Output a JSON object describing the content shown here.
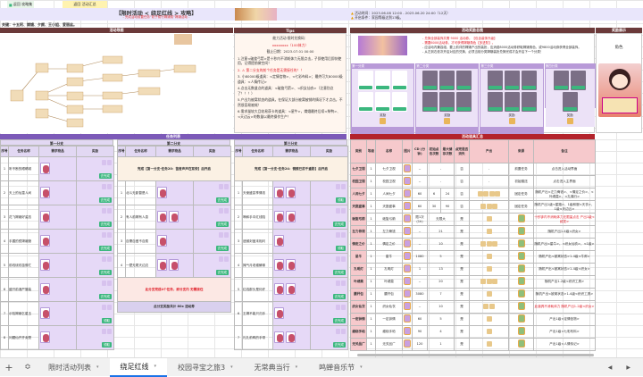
{
  "top": {
    "back_button": "返回 攻略集",
    "back_list_button": "返回 活动汇总"
  },
  "banner": {
    "title": "【限时活动 < 绕足红线 > 攻略】",
    "subtitle": "- 完成活动前置任务“奶子前行嫦娥前“嫦娥活动 -",
    "time": "活动时间：2023.06.08 12:00 - 2023.06.20 24:00（12天）",
    "condition": "开启条件：家园等级达到13级。"
  },
  "keywords": "关键：十五阿、嫦娥、夕颜、王小姐、爱丽丝。",
  "headers": {
    "map": "活动导图",
    "tips": "Tips",
    "rewards": "活动奖励总揽",
    "showcase": "奖励展示",
    "tasks": "任务列表",
    "items": "活动道具汇总",
    "showcase_label": "角色"
  },
  "tips": [
    {
      "text": "能力活动·限时兑换码：",
      "cls": ""
    },
    {
      "text": "xxxxxxxx（100体力）",
      "cls": "red"
    },
    {
      "text": "截止日期：2023.07.01 00:00",
      "cls": ""
    },
    {
      "text": "1.注意<破旋弓箭>是十秒内不消耗体力无限点击，子即使用后即刻使用，记得提前做空间！",
      "cls": ""
    },
    {
      "text": "2. ⚠ 第二分支的前个任务是无需接任的！！",
      "cls": "red"
    },
    {
      "text": "3. 小80000级道具：<定情信物>、<七彩布料>；最终可大80000级道具：<人情传记>",
      "cls": ""
    },
    {
      "text": "4.点击无数道点的道具：<破旋弓箭>、<织女仙衣>（注意别点了！！！）",
      "cls": ""
    },
    {
      "text": "5.产出为被窝状态的道具，在保证大部分被窝被销的情况下才点击，不然很容易被耗！",
      "cls": ""
    },
    {
      "text": "6.需求量较大且较易获卡的道具：<星牛>，嫦娥最终后续<柴鸭>、<天边云>的数量以最终操作生产！",
      "cls": ""
    }
  ],
  "rewards_panel": {
    "notes": [
      "- 兑换全部装饰共需 9000 活动券。【包含装饰升级】",
      "- 需要6000活动券，才可获得嫦娥角色【多进阶】。",
      "- 应活动内兼容组，要上前详的嫦娥产出的装扮，应消费8000活动券获取嫦娥角色，或9800活动券获得全部装饰。",
      "- 从左到右依次开启对应的兑换，必须当前分类嫦娥装扮兑换完成才会开启下一个分类！"
    ],
    "groups": [
      {
        "label": "第一分类",
        "cards": 6,
        "color": "#ffffff"
      },
      {
        "label": "第二分类",
        "cards": 6,
        "color": "#7b6f86"
      },
      {
        "label": "第三分类",
        "cards": 6,
        "color": "#7b6f86"
      },
      {
        "label": "第四分类",
        "cards": 3,
        "color": "#7b6f86"
      }
    ],
    "group_reward_label": "奖励"
  },
  "task_list": {
    "branches": [
      "第一分支",
      "第二分支",
      "第三分支"
    ],
    "columns": [
      "序号",
      "任务名称",
      "需求物品",
      "奖励"
    ],
    "branch1": [
      {
        "no": "1",
        "name": "听不断的眼睛城",
        "req": 1,
        "btn": "去完成"
      },
      {
        "no": "2",
        "name": "天上的仙童人间",
        "req": 1,
        "btn": "去完成"
      },
      {
        "no": "3",
        "name": "花飞嫦娥好姿态",
        "req": 1,
        "btn": "去完成"
      },
      {
        "no": "4",
        "name": "手握的镜嫦娥娘",
        "req": 1,
        "btn": "去完成"
      },
      {
        "no": "5",
        "name": "前线绕线苗佛忙",
        "req": 1,
        "btn": "去完成"
      },
      {
        "no": "6",
        "name": "盛开前港严管装",
        "req": 1,
        "btn": "去完成"
      },
      {
        "no": "7",
        "name": "示险嫦娥乞星玉",
        "req": 1,
        "btn": "领取"
      },
      {
        "no": "8",
        "name": "问题仙齐齐卖楚",
        "req": 1,
        "btn": "领取"
      }
    ],
    "branch2_locked": "完成【第一分支-任务20：笛音声声在耳旁】后开启",
    "branch2": [
      {
        "no": "1",
        "name": "北斗无影替是人",
        "req": 1,
        "btn": "去完成"
      },
      {
        "no": "2",
        "name": "有人前嫦有人息",
        "req": 2,
        "btn": "去完成"
      },
      {
        "no": "3",
        "name": "自需自爱不自费",
        "req": 1,
        "btn": "去完成"
      },
      {
        "no": "4",
        "name": "一壁无尾天边边",
        "req": 2,
        "btn": "去完成"
      }
    ],
    "branch2_note": "此分支完成4个任务，即分支内 无需接任",
    "branch2_total": "此分支奖励共计 80x 活动券",
    "branch3_locked": "完成【第一分支-任务24：镜镜已前千重影】后开启",
    "branch3": [
      {
        "no": "1",
        "name": "天使盛宴享情浓",
        "req": 2,
        "btn": "领取"
      },
      {
        "no": "2",
        "name": "嘀和手中红线陷",
        "req": 2,
        "btn": "去完成"
      },
      {
        "no": "3",
        "name": "遗憾封盖末相问",
        "req": 1,
        "btn": "领取"
      },
      {
        "no": "4",
        "name": "掩气月老缠解缘",
        "req": 2,
        "btn": "去完成"
      },
      {
        "no": "5",
        "name": "红线那头是何许",
        "req": 2,
        "btn": "去完成"
      },
      {
        "no": "6",
        "name": "王嫦不能只归手",
        "req": 1,
        "btn": "去完成"
      },
      {
        "no": "7",
        "name": "礼扎前鸭的手带",
        "req": 2,
        "btn": "去完成"
      }
    ]
  },
  "items_table": {
    "columns": [
      "类别",
      "等级",
      "名称",
      "图片",
      "CD\n(分钟)",
      "初始点击次数",
      "最大储存次数",
      "点完是否消失",
      "产出",
      "来源",
      "备注"
    ],
    "rows": [
      {
        "cat": "七夕卫视",
        "lv": "1",
        "name": "七夕卫视",
        "cd": "--",
        "init": "-",
        "max": "",
        "gone": "否",
        "out": 0,
        "src": "前置任务",
        "note": "点击进入活动界面",
        "red": false
      },
      {
        "cat": "校园卫视",
        "lv": "1",
        "name": "校园卫视",
        "cd": "--",
        "init": "-",
        "max": "",
        "gone": "否",
        "out": 0,
        "src": "初始赠送",
        "note": "点击进入主界面",
        "red": false
      },
      {
        "cat": "人间七夕",
        "lv": "1",
        "name": "人间七夕",
        "cd": "60",
        "init": "6",
        "max": "24",
        "gone": "否",
        "out": 4,
        "src": "固定任务",
        "note": "随机产出<左力骨钱>、<情定之价>、<叶绣莫>、<扎绳行>",
        "red": false
      },
      {
        "cat": "天庭盛事",
        "lv": "1",
        "name": "天庭盛事",
        "cd": "60",
        "init": "30",
        "max": "90",
        "gone": "否",
        "out": 3,
        "src": "固定任务",
        "note": "随机产出1级<星路>、1级和服<天衣>、1级<天边云>",
        "red": false
      },
      {
        "cat": "破旋弓箭",
        "lv": "1",
        "name": "破旋弓箭",
        "cd": "限1次(1h)",
        "init": "无限大",
        "max": "",
        "gone": "是",
        "out": 1,
        "src": "",
        "note": "十秒钟内不消耗体力无限量点击 产出1级<绒发>",
        "red": true
      },
      {
        "cat": "左力骨钱",
        "lv": "1",
        "name": "左力骨钱",
        "cd": "--",
        "init": "21",
        "max": "",
        "gone": "是",
        "out": 1,
        "src": "",
        "note": "随机产出1-4级<织女>",
        "red": false
      },
      {
        "cat": "情定之价",
        "lv": "1",
        "name": "情定之价",
        "cd": "--",
        "init": "10",
        "max": "",
        "gone": "是",
        "out": 3,
        "src": "",
        "note": "随机产出<星牛>、<织女仙衣>、<1级>",
        "red": false
      },
      {
        "cat": "星牛",
        "lv": "1",
        "name": "星牛",
        "cd": "1080",
        "init": "5",
        "max": "",
        "gone": "是",
        "out": 1,
        "src": "",
        "note": "随机产出<被窝状态>1-4级<牛郎>",
        "red": false
      },
      {
        "cat": "孔明灯",
        "lv": "1",
        "name": "孔明灯",
        "cd": "1",
        "init": "13",
        "max": "",
        "gone": "是",
        "out": 1,
        "src": "",
        "note": "随机产出<被窝状态>1-4级<织女>",
        "red": false
      },
      {
        "cat": "叶绣莫",
        "lv": "1",
        "name": "叶绣莫",
        "cd": "--",
        "init": "20",
        "max": "",
        "gone": "是",
        "out": 3,
        "src": "",
        "note": "随机产出1-2级<织织工具>",
        "red": false
      },
      {
        "cat": "腰杆包",
        "lv": "1",
        "name": "腰杆包",
        "cd": "3080",
        "init": "7",
        "max": "",
        "gone": "是",
        "out": 1,
        "src": "",
        "note": "随机产出<被窝状态>1-4级<织织工具>",
        "red": false
      },
      {
        "cat": "织女仙衣",
        "lv": "1",
        "name": "织女仙衣",
        "cd": "--",
        "init": "10",
        "max": "",
        "gone": "是",
        "out": 2,
        "src": "",
        "note": "此道具不消耗体力 随机产出1-2级<织女>",
        "red": true
      },
      {
        "cat": "一定钟情",
        "lv": "1",
        "name": "一定钟情",
        "cd": "60",
        "init": "5",
        "max": "",
        "gone": "是",
        "out": 1,
        "src": "",
        "note": "产出1级<定情信物>",
        "red": false
      },
      {
        "cat": "缠绕手帕",
        "lv": "1",
        "name": "缠绕手帕",
        "cd": "90",
        "init": "4",
        "max": "",
        "gone": "是",
        "out": 1,
        "src": "",
        "note": "产出1级<七彩布料>",
        "red": false
      },
      {
        "cat": "无关品广",
        "lv": "1",
        "name": "无关品广",
        "cd": "120",
        "init": "1",
        "max": "",
        "gone": "是",
        "out": 1,
        "src": "",
        "note": "产出1级<人情传记>",
        "red": false
      }
    ]
  },
  "sheet_tabs": [
    {
      "label": "限时活动列表",
      "active": false
    },
    {
      "label": "绕足红线",
      "active": true
    },
    {
      "label": "校园寻宝之旅3",
      "active": false
    },
    {
      "label": "无常典当行",
      "active": false
    },
    {
      "label": "鸣蝉音乐节",
      "active": false
    }
  ],
  "colors": {
    "header": "#6b3a3a",
    "purple": "#7c5ab8",
    "items_header": "#f6c9cc",
    "banner": "#e9e6fb",
    "go": "#3bb77e"
  }
}
